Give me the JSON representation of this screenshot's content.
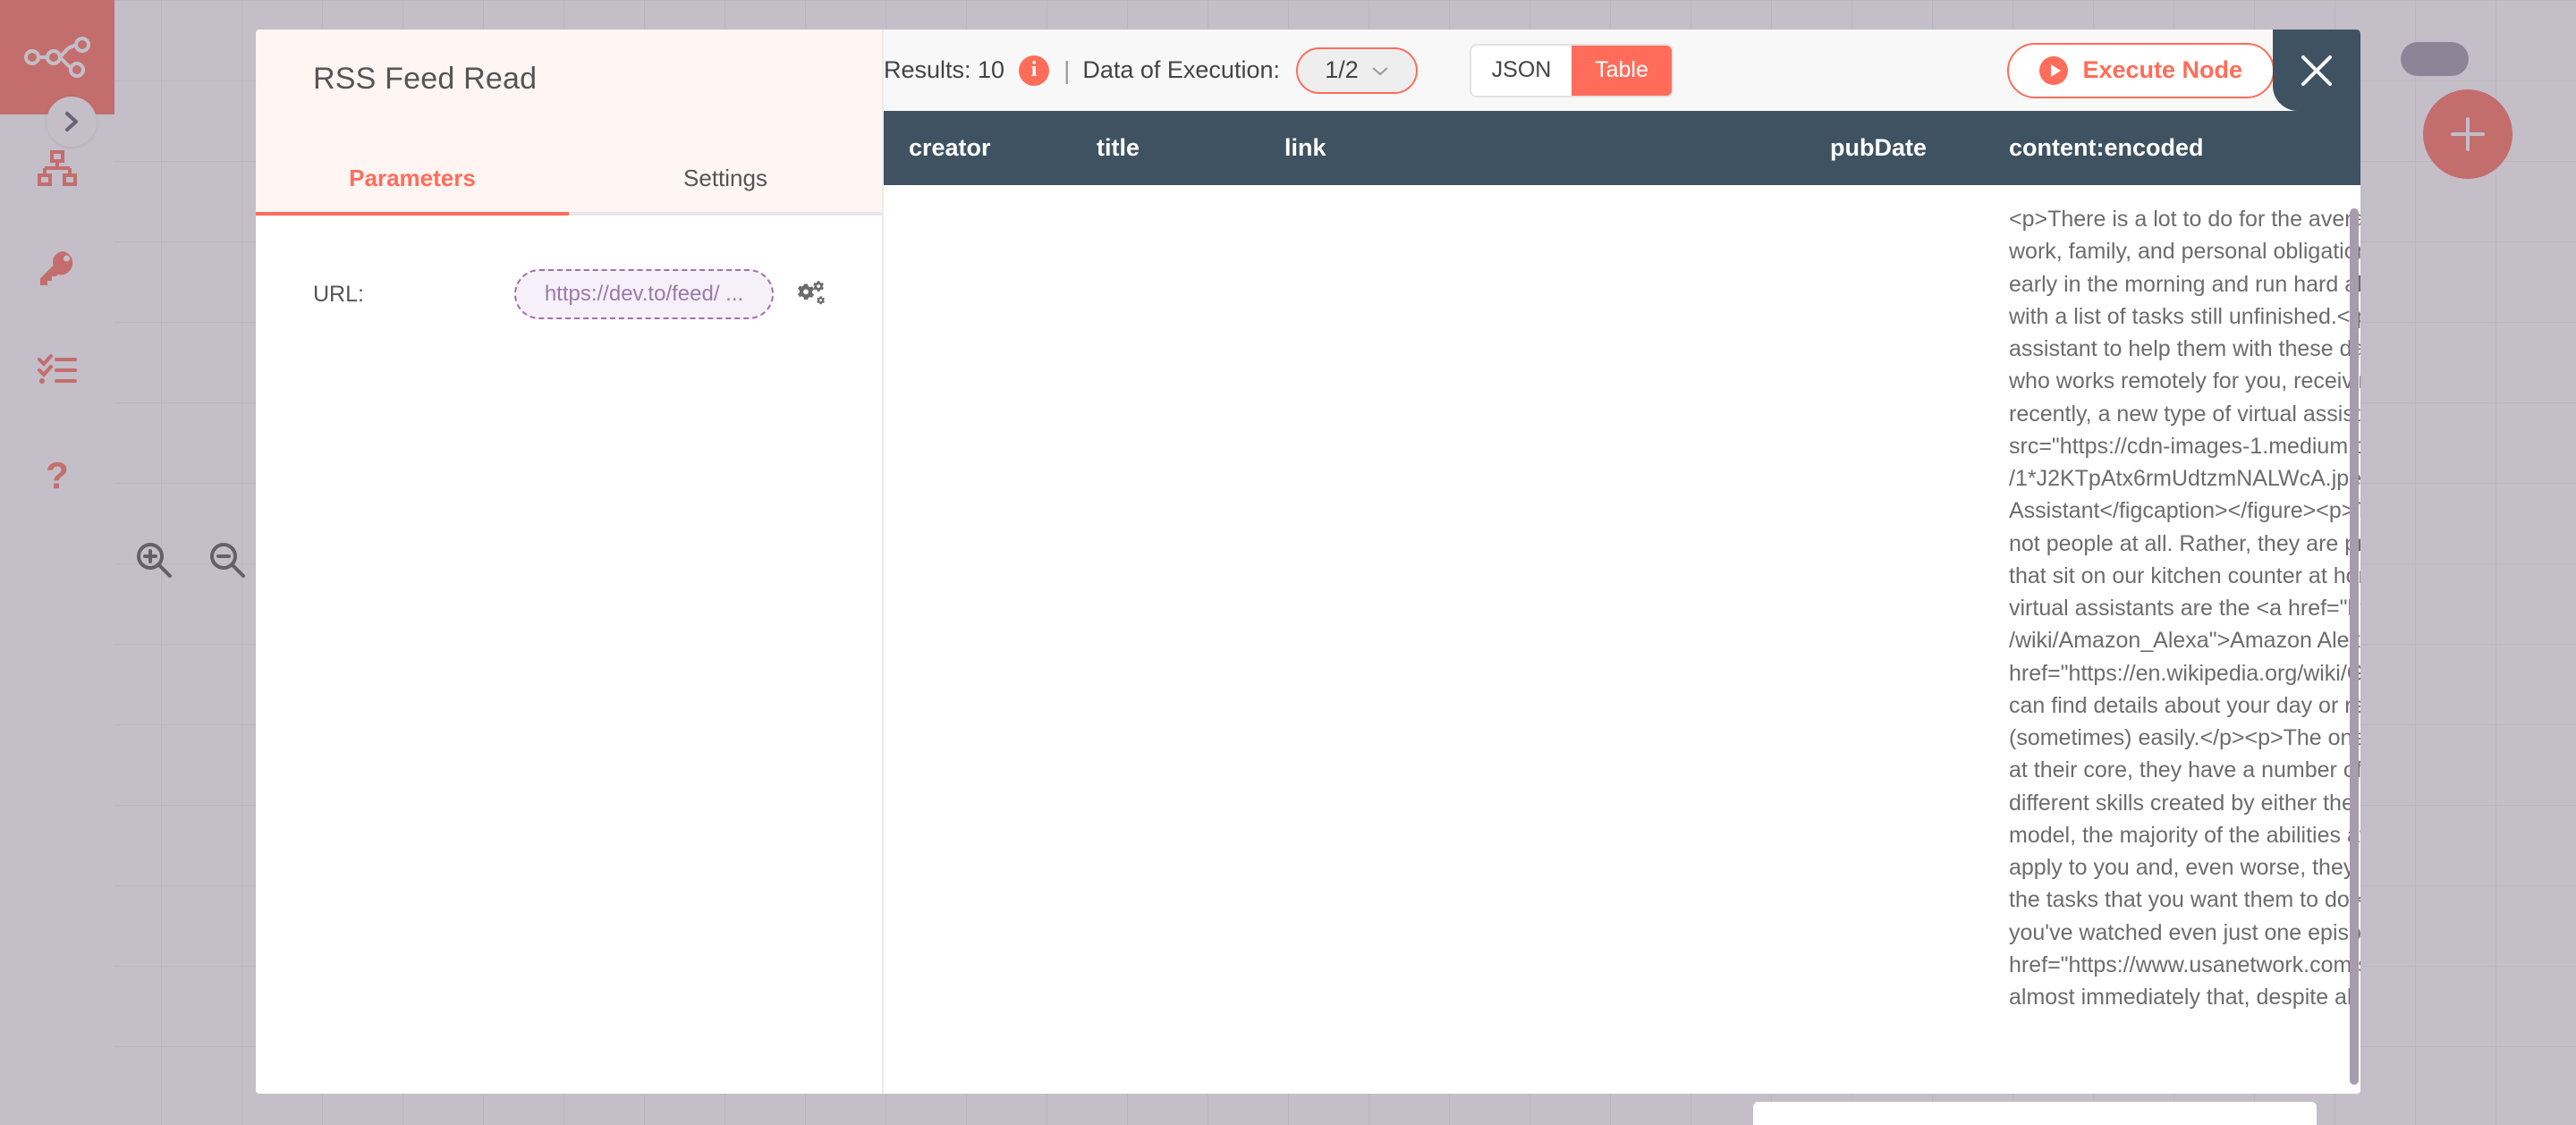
{
  "sidebar": {
    "logo_icon": "workflow-nodes-icon",
    "expand_icon": "chevron-right-icon",
    "items": [
      {
        "icon": "sitemap-icon",
        "name": "workflows"
      },
      {
        "icon": "key-icon",
        "name": "credentials"
      },
      {
        "icon": "checklist-icon",
        "name": "executions"
      },
      {
        "icon": "question-mark-icon",
        "name": "help"
      }
    ],
    "zoom_in_icon": "zoom-in-icon",
    "zoom_out_icon": "zoom-out-icon",
    "add_node_icon": "plus-icon"
  },
  "node_panel": {
    "title": "RSS Feed Read",
    "tabs": [
      {
        "label": "Parameters",
        "active": true
      },
      {
        "label": "Settings",
        "active": false
      }
    ],
    "parameters": [
      {
        "label": "URL:",
        "value": "https://dev.to/feed/ ...",
        "gear_icon": "settings-gear-icon"
      }
    ]
  },
  "output_panel": {
    "results_label": "Results: 10",
    "info_icon": "info-icon",
    "separator": "|",
    "execution_label": "Data of Execution:",
    "execution_value": "1/2",
    "chevron_icon": "chevron-down-icon",
    "view_modes": [
      {
        "label": "JSON",
        "active": false
      },
      {
        "label": "Table",
        "active": true
      }
    ],
    "execute_button": "Execute Node",
    "play_icon": "play-circle-icon",
    "close_icon": "close-x-icon",
    "table": {
      "columns": [
        "creator",
        "title",
        "link",
        "pubDate",
        "content:encoded"
      ],
      "rows": [
        {
          "creator": "",
          "title": "",
          "link": "",
          "pubDate": "",
          "content": "<p>There is a lot to do for the average\nwork, family, and personal obligations,\nearly in the morning and run hard all c\nwith a list of tasks still unfinished.</p>\nassistant to help them with these daily\nwho works remotely for you, receiving\nrecently, a new type of virtual assistan\nsrc=\"https://cdn-images-1.medium.co\n/1*J2KTpAtx6rmUdtzmNALWcA.jpeg\" \nAssistant</figcaption></figure><p>Thi\nnot people at all. Rather, they are prog\nthat sit on our kitchen counter at hom\nvirtual assistants are the <a href=\"http\n/wiki/Amazon_Alexa\">Amazon Alexa</\nhref=\"https://en.wikipedia.org/wiki/Go\ncan find details about your day or retr\n(sometimes) easily.</p><p>The one ch\nat their core, they have a number of b\ndifferent skills created by either the m\nmodel, the majority of the abilities ava\napply to you and, even worse, they ma\nthe tasks that you want them to do.</p\nyou've watched even just one episode\nhref=\"https://www.usanetwork.com/su\nalmost immediately that, despite all of"
        }
      ]
    }
  },
  "colors": {
    "accent": "#ff6d5a",
    "header_dark": "#3f5261",
    "panel_header_bg": "#fff5f3",
    "param_border": "#a36fa6",
    "param_bg": "#f6f0fb",
    "overlay": "#7a6e85"
  }
}
